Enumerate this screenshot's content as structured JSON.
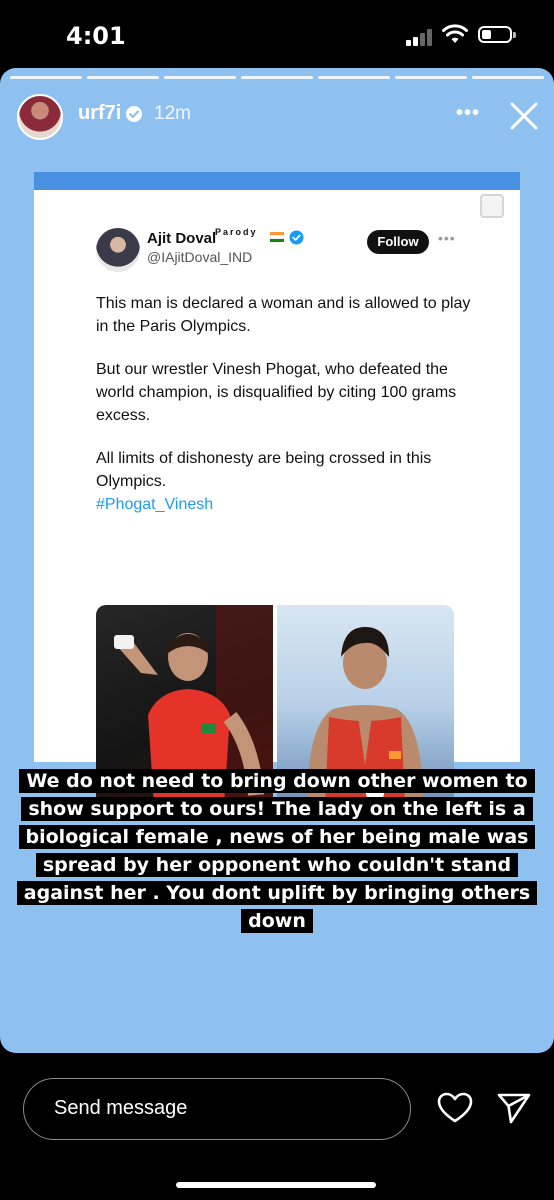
{
  "status_bar": {
    "time": "4:01"
  },
  "story": {
    "username": "urf7i",
    "posted_ago": "12m",
    "background_color": "#8fc1f0"
  },
  "tweet": {
    "name": "Ajit Doval",
    "parody_label": "Parody",
    "handle": "@IAjitDoval_IND",
    "follow_label": "Follow",
    "paragraphs": [
      "This man is declared a woman and is allowed to play in the Paris Olympics.",
      "But our wrestler Vinesh Phogat, who defeated the world champion, is disqualified by citing 100 grams excess.",
      "All limits of dishonesty are being crossed in this Olympics."
    ],
    "hashtag": "#Phogat_Vinesh"
  },
  "caption": {
    "lines": [
      "We do not need to bring down other women to",
      "show support to ours! The lady on the left is a",
      "biological female , news of her being male was",
      "spread by her opponent who couldn't stand",
      "against her . You dont uplift  by bringing others",
      "down"
    ]
  },
  "footer": {
    "message_placeholder": "Send message"
  }
}
